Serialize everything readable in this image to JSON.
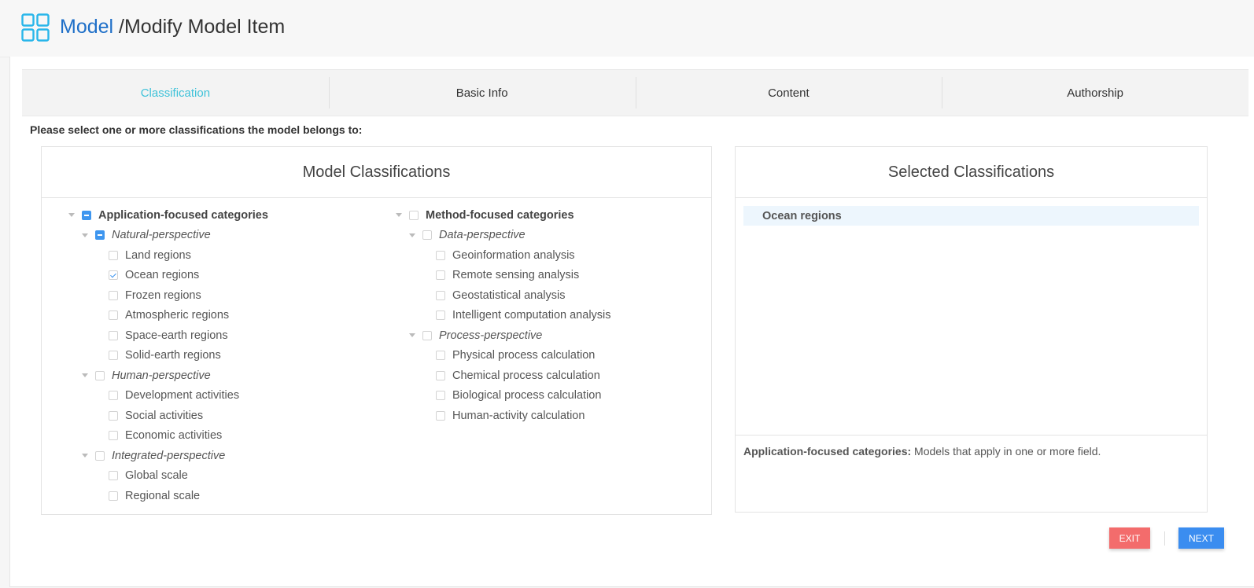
{
  "header": {
    "logo_icon": "grid-icon",
    "crumb_link": "Model",
    "crumb_current": " /Modify Model Item"
  },
  "tabs": [
    {
      "label": "Classification",
      "active": true
    },
    {
      "label": "Basic Info",
      "active": false
    },
    {
      "label": "Content",
      "active": false
    },
    {
      "label": "Authorship",
      "active": false
    }
  ],
  "prompt": "Please select one or more classifications the model belongs to:",
  "model_panel": {
    "title": "Model Classifications",
    "columns": [
      [
        {
          "label": "Application-focused categories",
          "level": 0,
          "state": "half",
          "expandable": true
        },
        {
          "label": "Natural-perspective",
          "level": 1,
          "state": "half",
          "expandable": true
        },
        {
          "label": "Land regions",
          "level": 2,
          "state": "unchecked"
        },
        {
          "label": "Ocean regions",
          "level": 2,
          "state": "checked"
        },
        {
          "label": "Frozen regions",
          "level": 2,
          "state": "unchecked"
        },
        {
          "label": "Atmospheric regions",
          "level": 2,
          "state": "unchecked"
        },
        {
          "label": "Space-earth regions",
          "level": 2,
          "state": "unchecked"
        },
        {
          "label": "Solid-earth regions",
          "level": 2,
          "state": "unchecked"
        },
        {
          "label": "Human-perspective",
          "level": 1,
          "state": "unchecked",
          "expandable": true
        },
        {
          "label": "Development activities",
          "level": 2,
          "state": "unchecked"
        },
        {
          "label": "Social activities",
          "level": 2,
          "state": "unchecked"
        },
        {
          "label": "Economic activities",
          "level": 2,
          "state": "unchecked"
        },
        {
          "label": "Integrated-perspective",
          "level": 1,
          "state": "unchecked",
          "expandable": true
        },
        {
          "label": "Global scale",
          "level": 2,
          "state": "unchecked"
        },
        {
          "label": "Regional scale",
          "level": 2,
          "state": "unchecked"
        }
      ],
      [
        {
          "label": "Method-focused categories",
          "level": 0,
          "state": "unchecked",
          "expandable": true
        },
        {
          "label": "Data-perspective",
          "level": 1,
          "state": "unchecked",
          "expandable": true
        },
        {
          "label": "Geoinformation analysis",
          "level": 2,
          "state": "unchecked"
        },
        {
          "label": "Remote sensing analysis",
          "level": 2,
          "state": "unchecked"
        },
        {
          "label": "Geostatistical analysis",
          "level": 2,
          "state": "unchecked"
        },
        {
          "label": "Intelligent computation analysis",
          "level": 2,
          "state": "unchecked"
        },
        {
          "label": "Process-perspective",
          "level": 1,
          "state": "unchecked",
          "expandable": true
        },
        {
          "label": "Physical process calculation",
          "level": 2,
          "state": "unchecked"
        },
        {
          "label": "Chemical process calculation",
          "level": 2,
          "state": "unchecked"
        },
        {
          "label": "Biological process calculation",
          "level": 2,
          "state": "unchecked"
        },
        {
          "label": "Human-activity calculation",
          "level": 2,
          "state": "unchecked"
        }
      ]
    ]
  },
  "selected_panel": {
    "title": "Selected Classifications",
    "items": [
      "Ocean regions"
    ]
  },
  "description": {
    "label": "Application-focused categories:",
    "text": " Models that apply in one or more field."
  },
  "buttons": {
    "exit": "EXIT",
    "next": "NEXT"
  },
  "colors": {
    "accent": "#3fc2d9",
    "link": "#1e6fc8",
    "checkbox": "#3e96ef",
    "exit": "#f36c6c",
    "next": "#3b8df0"
  }
}
